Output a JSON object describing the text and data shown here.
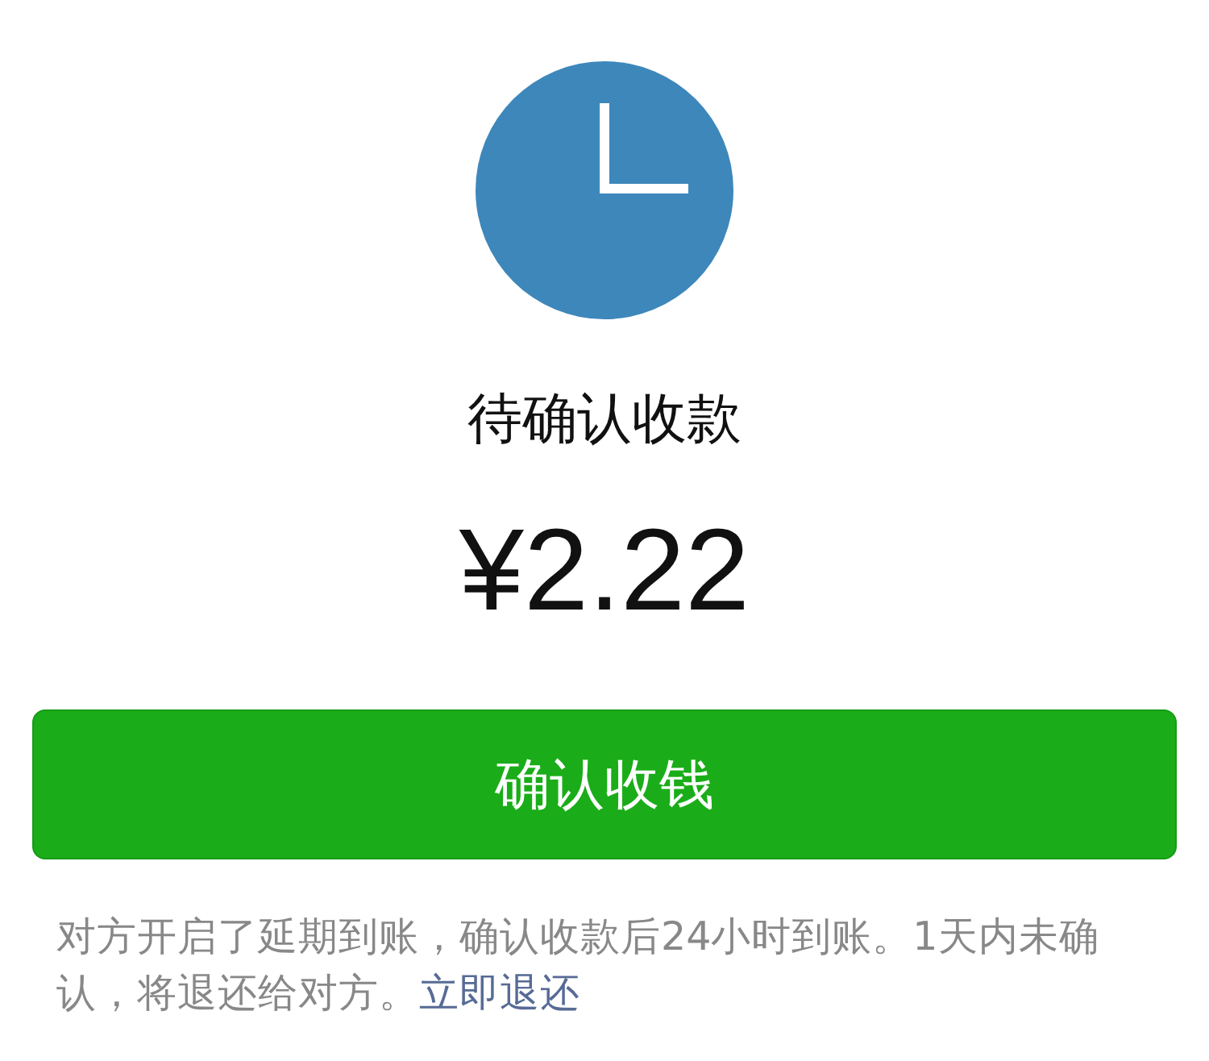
{
  "status": {
    "title": "待确认收款",
    "amount": "¥2.22"
  },
  "button": {
    "label": "确认收钱"
  },
  "note": {
    "text": "对方开启了延期到账，确认收款后24小时到账。1天内未确认，将退还给对方。",
    "link": "立即退还"
  }
}
